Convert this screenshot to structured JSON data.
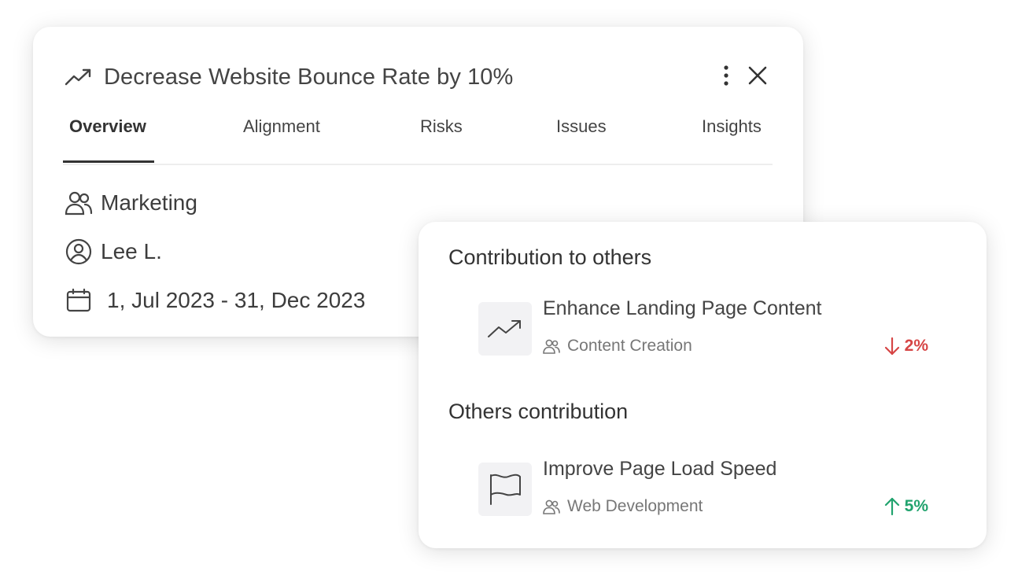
{
  "goal": {
    "title": "Decrease Website Bounce Rate by 10%",
    "icon": "trending-up-icon"
  },
  "tabs": [
    {
      "label": "Overview",
      "active": true
    },
    {
      "label": "Alignment",
      "active": false
    },
    {
      "label": "Risks",
      "active": false
    },
    {
      "label": "Issues",
      "active": false
    },
    {
      "label": "Insights",
      "active": false
    }
  ],
  "details": {
    "team": "Marketing",
    "owner": "Lee L.",
    "date_range": "1, Jul 2023 - 31, Dec 2023"
  },
  "contribution_to_others": {
    "title": "Contribution to others",
    "items": [
      {
        "title": "Enhance Landing Page Content",
        "team": "Content Creation",
        "change": "2%",
        "direction": "down",
        "icon": "trending-up-icon"
      }
    ]
  },
  "others_contribution": {
    "title": "Others contribution",
    "items": [
      {
        "title": "Improve Page Load Speed",
        "team": "Web Development",
        "change": "5%",
        "direction": "up",
        "icon": "flag-icon"
      }
    ]
  },
  "colors": {
    "negative": "#d64545",
    "positive": "#21a36e",
    "text": "#444444",
    "icon_tile": "#f2f2f4"
  }
}
